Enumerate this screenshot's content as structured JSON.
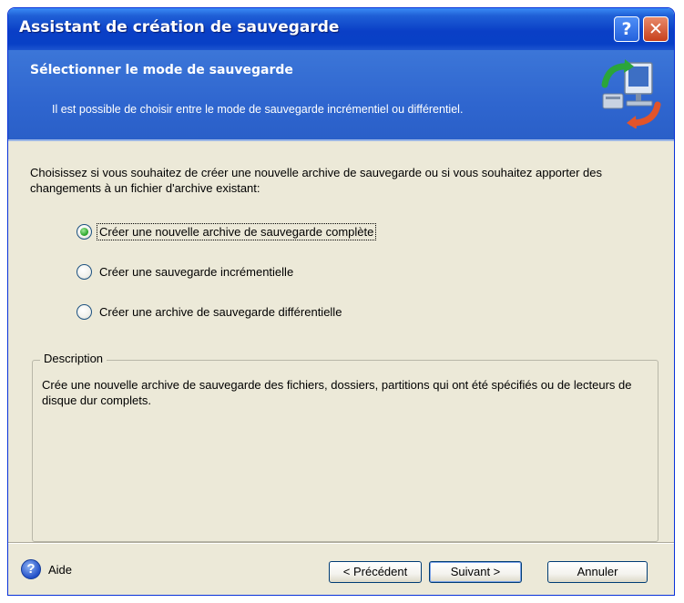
{
  "window": {
    "title": "Assistant de création de sauvegarde",
    "help_glyph": "?",
    "close_glyph": "✕"
  },
  "header": {
    "title": "Sélectionner le mode de sauvegarde",
    "subtitle": "Il est possible de choisir entre le mode de sauvegarde incrémentiel ou différentiel.",
    "icon": "backup-computer-icon"
  },
  "content": {
    "prompt": "Choisissez si vous souhaitez de créer une nouvelle archive de sauvegarde ou si vous souhaitez apporter des changements à un fichier d'archive existant:",
    "options": [
      {
        "label": "Créer une nouvelle archive de sauvegarde complète",
        "checked": true
      },
      {
        "label": "Créer une sauvegarde incrémentielle",
        "checked": false
      },
      {
        "label": "Créer une archive de sauvegarde différentielle",
        "checked": false
      }
    ],
    "description": {
      "legend": "Description",
      "text": "Crée une nouvelle archive de sauvegarde des fichiers, dossiers, partitions qui ont été spécifiés ou de lecteurs de disque dur complets."
    }
  },
  "footer": {
    "help_label": "Aide",
    "help_icon_glyph": "?",
    "back_label": "< Précédent",
    "next_label": "Suivant >",
    "cancel_label": "Annuler"
  },
  "colors": {
    "titlebar": "#0a3fc6",
    "header": "#2f66cf",
    "dialog_bg": "#ece9d8",
    "radio_checked": "#21a121"
  }
}
